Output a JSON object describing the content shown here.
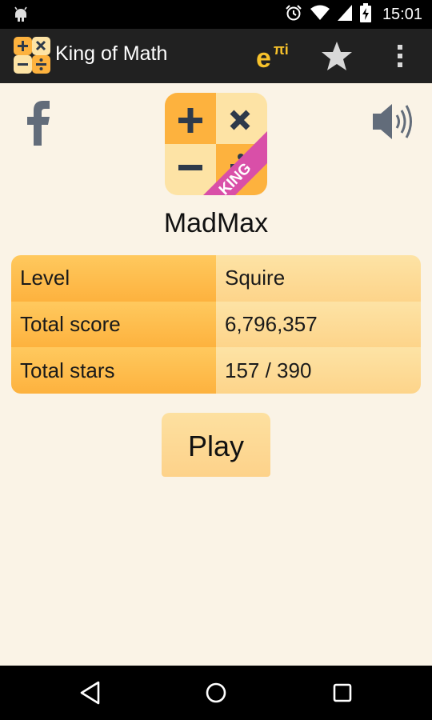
{
  "status_bar": {
    "time": "15:01",
    "icons": [
      "android-debug-icon",
      "alarm-icon",
      "wifi-icon",
      "signal-icon",
      "battery-charging-icon"
    ]
  },
  "action_bar": {
    "title": "King of Math",
    "epi_glyph": "e",
    "epi_super": "πi",
    "icons": [
      "app-logo-icon",
      "epi-icon",
      "star-icon",
      "overflow-menu-icon"
    ]
  },
  "main": {
    "player_name": "MadMax",
    "logo_badge": "KING",
    "stats": [
      {
        "label": "Level",
        "value": "Squire"
      },
      {
        "label": "Total score",
        "value": "6,796,357"
      },
      {
        "label": "Total stars",
        "value": "157 / 390"
      }
    ],
    "play_label": "Play"
  },
  "colors": {
    "orange_dark": "#fdb23e",
    "orange_light": "#fde3a5",
    "background": "#faf3e6",
    "icon_gray": "#626c7a",
    "king_ribbon": "#d94fa8"
  }
}
